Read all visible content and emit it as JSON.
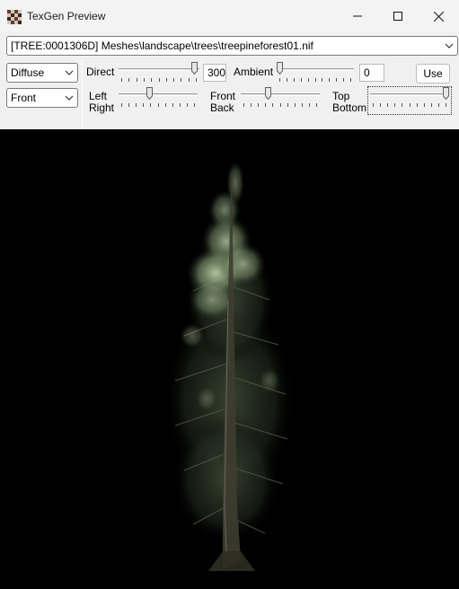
{
  "window": {
    "title": "TexGen Preview",
    "icon": "texgen-app-icon",
    "controls": [
      "minimize-icon",
      "maximize-icon",
      "close-icon"
    ]
  },
  "mesh_selector": {
    "value": "[TREE:0001306D] Meshes\\landscape\\trees\\treepineforest01.nif"
  },
  "channel_select": {
    "value": "Diffuse"
  },
  "view_select": {
    "value": "Front"
  },
  "lighting": {
    "direct_label": "Direct",
    "direct_value": "300",
    "direct_fraction": 0.98,
    "ambient_label": "Ambient",
    "ambient_value": "0",
    "ambient_fraction": 0.0,
    "left_label": "Left",
    "right_label": "Right",
    "left_right_fraction": 0.38,
    "front_label": "Front",
    "back_label": "Back",
    "front_back_fraction": 0.33,
    "top_label": "Top",
    "bottom_label": "Bottom",
    "top_bottom_fraction": 1.0
  },
  "use_button": {
    "label": "Use"
  },
  "colors": {
    "viewport_bg": "#000000",
    "foliage_highlight": "#b7cfa6",
    "foliage_shadow": "#2f3b2a",
    "trunk": "#4a4a3a"
  }
}
